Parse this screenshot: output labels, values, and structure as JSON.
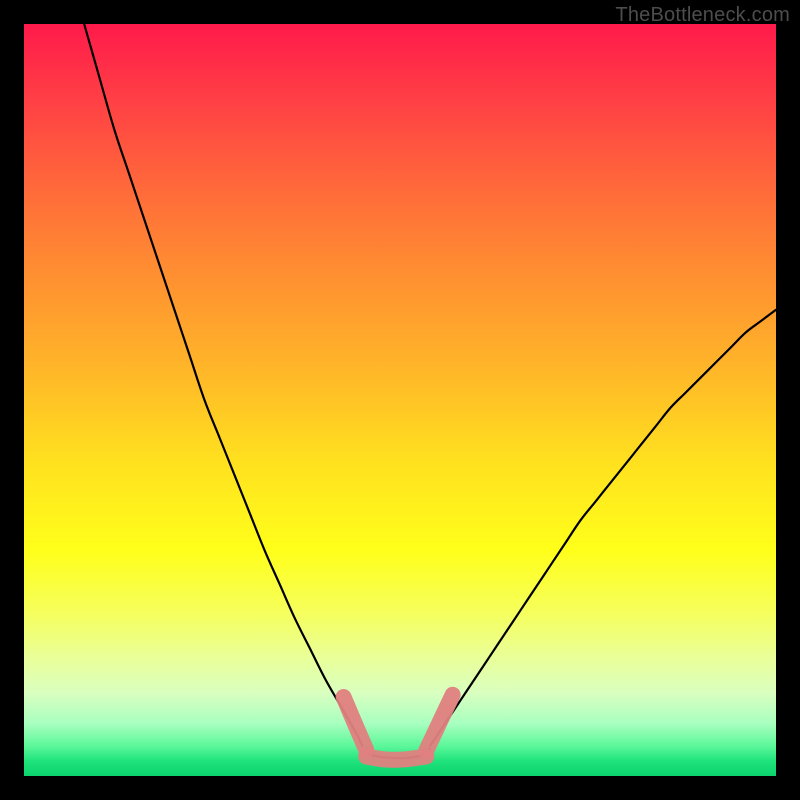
{
  "watermark": "TheBottleneck.com",
  "chart_data": {
    "type": "line",
    "title": "",
    "xlabel": "",
    "ylabel": "",
    "xlim": [
      0,
      100
    ],
    "ylim": [
      0,
      100
    ],
    "series": [
      {
        "name": "curve-left",
        "x": [
          8,
          10,
          12,
          14,
          16,
          18,
          20,
          22,
          24,
          26,
          28,
          30,
          32,
          34,
          36,
          38,
          40,
          42,
          44,
          45
        ],
        "y": [
          100,
          93,
          86,
          80,
          74,
          68,
          62,
          56,
          50,
          45,
          40,
          35,
          30,
          25.5,
          21,
          17,
          13,
          9.5,
          6,
          4
        ]
      },
      {
        "name": "curve-right",
        "x": [
          54,
          56,
          58,
          60,
          62,
          64,
          66,
          68,
          70,
          72,
          74,
          76,
          78,
          80,
          82,
          84,
          86,
          88,
          90,
          92,
          94,
          96,
          98,
          100
        ],
        "y": [
          4,
          7,
          10,
          13,
          16,
          19,
          22,
          25,
          28,
          31,
          34,
          36.5,
          39,
          41.5,
          44,
          46.5,
          49,
          51,
          53,
          55,
          57,
          59,
          60.5,
          62
        ]
      },
      {
        "name": "floor",
        "x": [
          45,
          47,
          49,
          51,
          53,
          54
        ],
        "y": [
          3.2,
          2.6,
          2.4,
          2.4,
          2.8,
          3.6
        ]
      }
    ],
    "highlight": {
      "name": "bottom-band",
      "color": "#e07f80",
      "segments": [
        {
          "x": [
            42.5,
            44.2,
            45.5
          ],
          "y": [
            10.5,
            6.5,
            3.5
          ]
        },
        {
          "x": [
            45.5,
            48,
            50.5,
            53.5
          ],
          "y": [
            2.6,
            2.2,
            2.2,
            2.6
          ]
        },
        {
          "x": [
            53.5,
            55.2,
            57
          ],
          "y": [
            3.4,
            7,
            10.8
          ]
        }
      ]
    },
    "colors": {
      "curve": "#000000",
      "highlight": "#e07f80",
      "gradient_top": "#ff1a4b",
      "gradient_mid": "#ffe01f",
      "gradient_bottom": "#0cd46e"
    }
  }
}
